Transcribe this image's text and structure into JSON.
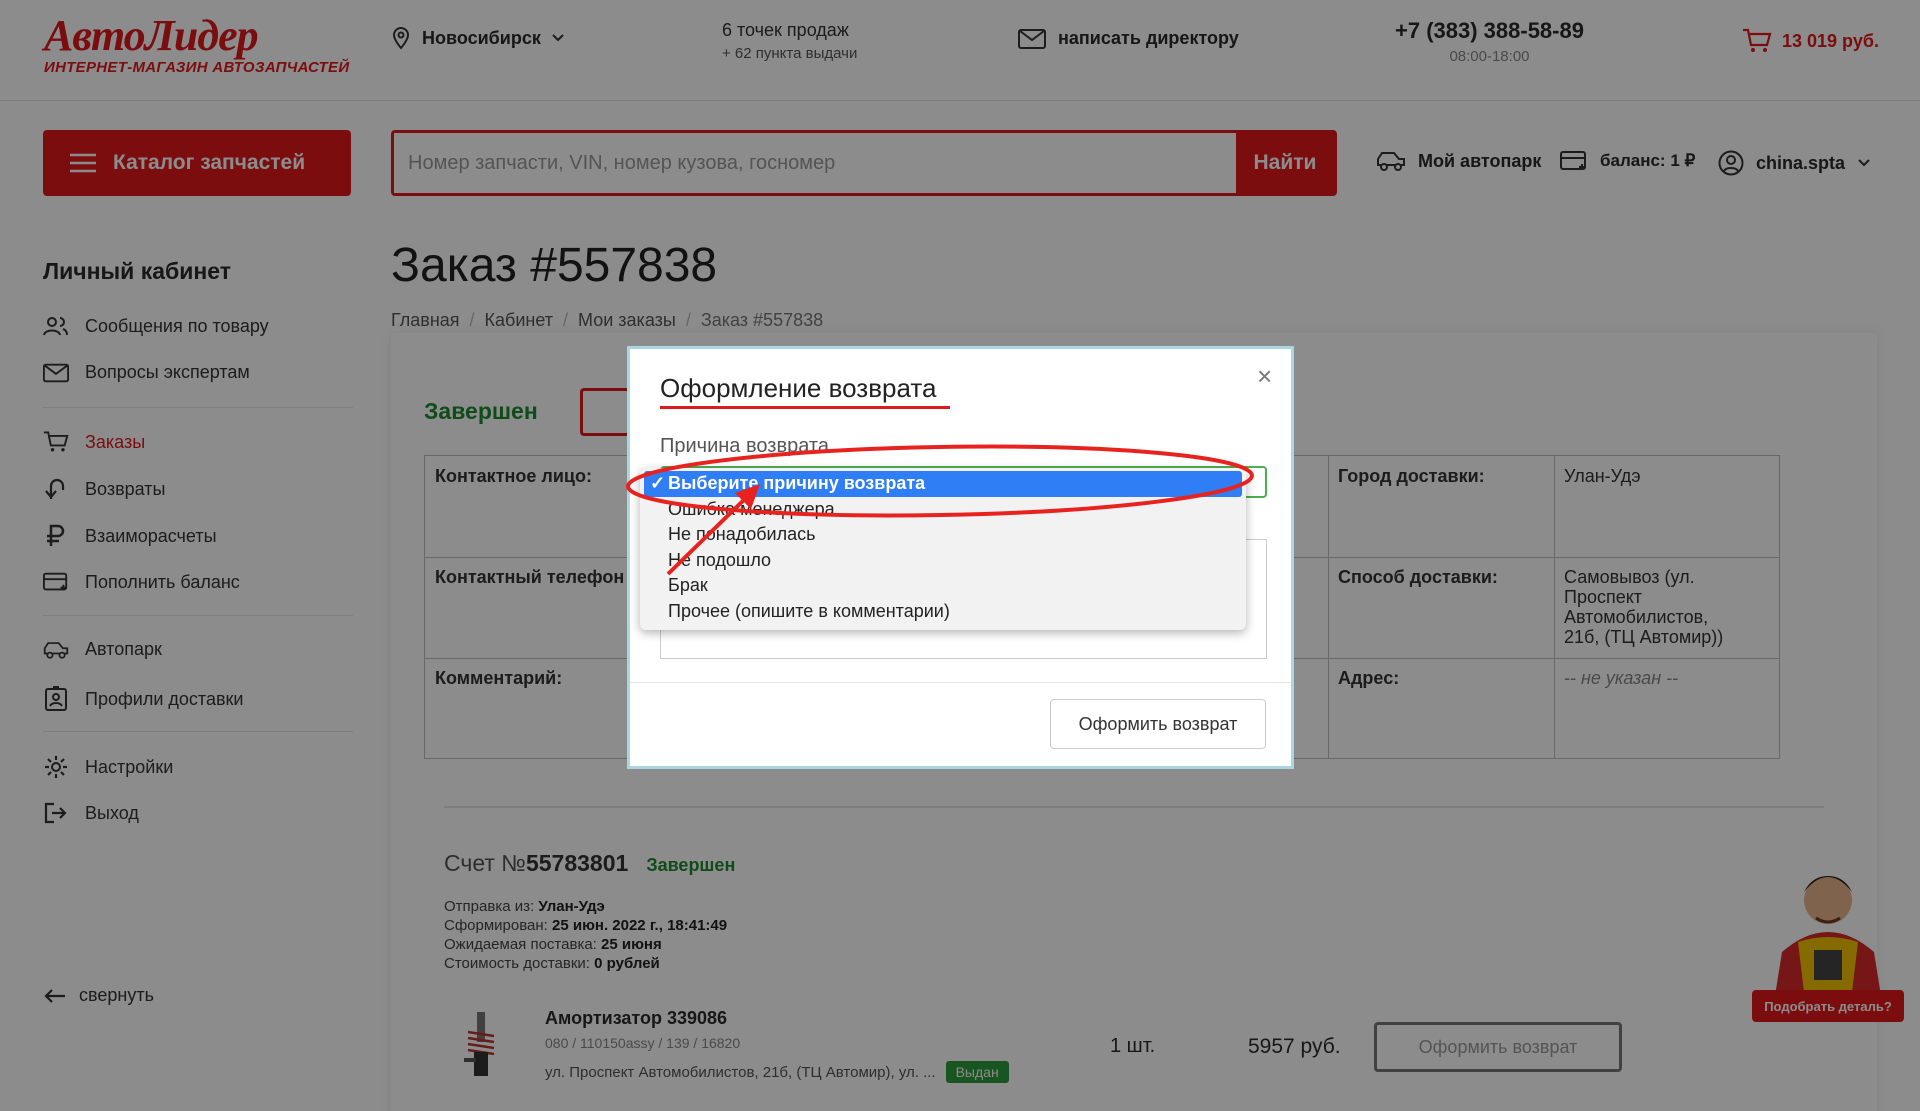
{
  "header": {
    "logo_main": "АвтоЛидер",
    "logo_sub": "ИНТЕРНЕТ-МАГАЗИН АВТОЗАПЧАСТЕЙ",
    "city": "Новосибирск",
    "points": "6 точек продаж",
    "pickup": "+ 62 пункта выдачи",
    "write_director": "написать директору",
    "phone": "+7 (383) 388-58-89",
    "hours": "08:00-18:00",
    "cart_total": "13 019 руб."
  },
  "toolbar": {
    "catalog_label": "Каталог запчастей",
    "search_placeholder": "Номер запчасти, VIN, номер кузова, госномер",
    "search_button": "Найти",
    "garage": "Мой автопарк",
    "balance": "баланс: 1 ₽",
    "username": "china.spta"
  },
  "sidebar": {
    "title": "Личный кабинет",
    "items": [
      {
        "label": "Сообщения по товару"
      },
      {
        "label": "Вопросы экспертам"
      },
      {
        "label": "Заказы"
      },
      {
        "label": "Возвраты"
      },
      {
        "label": "Взаиморасчеты"
      },
      {
        "label": "Пополнить баланс"
      },
      {
        "label": "Автопарк"
      },
      {
        "label": "Профили доставки"
      },
      {
        "label": "Настройки"
      },
      {
        "label": "Выход"
      }
    ],
    "collapse": "свернуть"
  },
  "main": {
    "title": "Заказ #557838",
    "breadcrumb": [
      "Главная",
      "Кабинет",
      "Мои заказы",
      "Заказ #557838"
    ],
    "status": "Завершен",
    "table": {
      "contact_label": "Контактное лицо:",
      "phone_label": "Контактный телефон",
      "comment_label": "Комментарий:",
      "city_label": "Город доставки:",
      "city_value": "Улан-Удэ",
      "delivery_label": "Способ доставки:",
      "delivery_value": "Самовывоз (ул. Проспект Автомобилистов, 21б, (ТЦ Автомир))",
      "address_label": "Адрес:",
      "address_value": "-- не указан --"
    },
    "invoice": {
      "prefix": "Счет №",
      "number": "55783801",
      "status": "Завершен",
      "ship_from_label": "Отправка из:",
      "ship_from": "Улан-Удэ",
      "formed_label": "Сформирован:",
      "formed": "25 июн. 2022 г., 18:41:49",
      "expected_label": "Ожидаемая поставка:",
      "expected": "25 июня",
      "cost_label": "Стоимость доставки:",
      "cost": "0 рублей"
    },
    "product": {
      "name": "Амортизатор 339086",
      "codes": "080 / 110150assy / 139 / 16820",
      "address": "ул. Проспект Автомобилистов, 21б, (ТЦ Автомир), ул. ...",
      "badge": "Выдан",
      "qty": "1 шт.",
      "price": "5957 руб.",
      "return_button": "Оформить возврат"
    },
    "mascot_button": "Подобрать деталь?"
  },
  "modal": {
    "title": "Оформление возврата",
    "close": "×",
    "reason_label": "Причина возврата",
    "options": [
      "Выберите причину возврата",
      "Ошибка менеджера",
      "Не понадобилась",
      "Не подошло",
      "Брак",
      "Прочее (опишите в комментарии)"
    ],
    "selected_index": 0,
    "submit": "Оформить возврат"
  },
  "colors": {
    "brand_red": "#e0191d",
    "status_green": "#1e8a2e",
    "select_blue": "#2f7ef5"
  }
}
